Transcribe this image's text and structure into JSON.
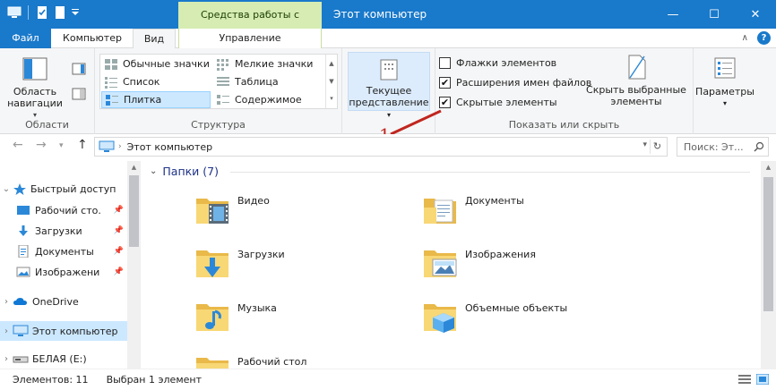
{
  "titlebar": {
    "context_tab": "Средства работы с дисками",
    "title": "Этот компьютер",
    "minimize": "—",
    "maximize": "☐",
    "close": "✕"
  },
  "tabs": {
    "file": "Файл",
    "computer": "Компьютер",
    "view": "Вид",
    "manage": "Управление"
  },
  "ribbon": {
    "areas": {
      "nav_pane_label": "Область навигации",
      "group_label": "Области"
    },
    "layout": {
      "items": [
        "Обычные значки",
        "Мелкие значки",
        "Список",
        "Таблица",
        "Плитка",
        "Содержимое"
      ],
      "selected": "Плитка",
      "group_label": "Структура"
    },
    "current_view": {
      "label": "Текущее представление"
    },
    "show_hide": {
      "item_checkboxes": "Флажки элементов",
      "file_extensions": "Расширения имен файлов",
      "hidden_items": "Скрытые элементы",
      "hide_selected": "Скрыть выбранные элементы",
      "group_label": "Показать или скрыть"
    },
    "options": {
      "label": "Параметры"
    }
  },
  "address": {
    "path": "Этот компьютер",
    "search_placeholder": "Поиск: Эт..."
  },
  "nav": {
    "quick_access": "Быстрый доступ",
    "desktop": "Рабочий сто.",
    "downloads": "Загрузки",
    "documents": "Документы",
    "pictures": "Изображени",
    "onedrive": "OneDrive",
    "this_pc": "Этот компьютер",
    "drive": "БЕЛАЯ (E:)"
  },
  "content": {
    "section": "Папки (7)",
    "folders": [
      "Видео",
      "Документы",
      "Загрузки",
      "Изображения",
      "Музыка",
      "Объемные объекты",
      "Рабочий стол"
    ]
  },
  "status": {
    "count": "Элементов: 11",
    "selected": "Выбран 1 элемент"
  },
  "annotation": {
    "number": "1"
  },
  "colors": {
    "accent": "#1979ca",
    "context_tab": "#d6ecb3",
    "selection": "#cce8ff",
    "folder": "#f8d775",
    "annotation": "#c0261f"
  }
}
